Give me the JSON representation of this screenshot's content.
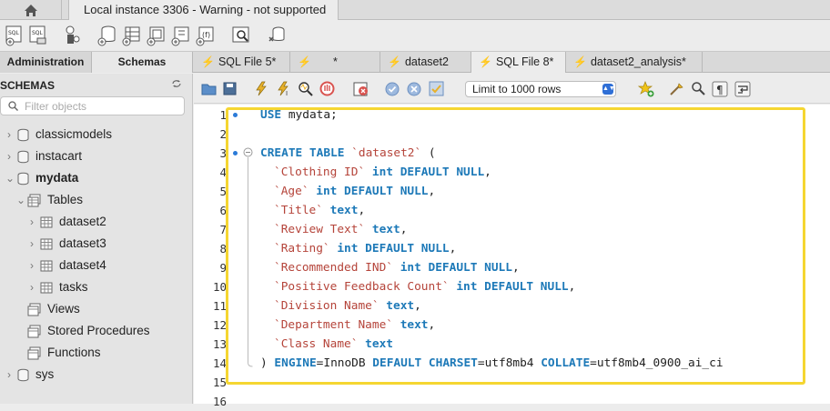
{
  "window": {
    "connection_tab": "Local instance 3306 - Warning - not supported"
  },
  "sidebar": {
    "tab_admin": "Administration",
    "tab_schemas": "Schemas",
    "title": "SCHEMAS",
    "filter_placeholder": "Filter objects",
    "tree": [
      {
        "label": "classicmodels"
      },
      {
        "label": "instacart"
      },
      {
        "label": "mydata"
      },
      {
        "label": "Tables"
      },
      {
        "label": "dataset2"
      },
      {
        "label": "dataset3"
      },
      {
        "label": "dataset4"
      },
      {
        "label": "tasks"
      },
      {
        "label": "Views"
      },
      {
        "label": "Stored Procedures"
      },
      {
        "label": "Functions"
      },
      {
        "label": "sys"
      }
    ]
  },
  "tabs": [
    {
      "label": "SQL File 5*"
    },
    {
      "label": "*"
    },
    {
      "label": "dataset2"
    },
    {
      "label": "SQL File 8*"
    },
    {
      "label": "dataset2_analysis*"
    }
  ],
  "editor_toolbar": {
    "limit_select": "Limit to 1000 rows"
  },
  "editor": {
    "line_numbers": [
      "1",
      "2",
      "3",
      "4",
      "5",
      "6",
      "7",
      "8",
      "9",
      "10",
      "11",
      "12",
      "13",
      "14",
      "15",
      "16"
    ],
    "lines": {
      "l1_kw": "USE",
      "l1_rest": " mydata;",
      "l3_kw": "CREATE TABLE",
      "l3_id": "`dataset2`",
      "l3_rest": " (",
      "l4_id": "`Clothing ID`",
      "l4_kw": " int DEFAULT NULL",
      "l4_rest": ",",
      "l5_id": "`Age`",
      "l5_kw": " int DEFAULT NULL",
      "l5_rest": ",",
      "l6_id": "`Title`",
      "l6_kw": " text",
      "l6_rest": ",",
      "l7_id": "`Review Text`",
      "l7_kw": " text",
      "l7_rest": ",",
      "l8_id": "`Rating`",
      "l8_kw": " int DEFAULT NULL",
      "l8_rest": ",",
      "l9_id": "`Recommended IND`",
      "l9_kw": " int DEFAULT NULL",
      "l9_rest": ",",
      "l10_id": "`Positive Feedback Count`",
      "l10_kw": " int DEFAULT NULL",
      "l10_rest": ",",
      "l11_id": "`Division Name`",
      "l11_kw": " text",
      "l11_rest": ",",
      "l12_id": "`Department Name`",
      "l12_kw": " text",
      "l12_rest": ",",
      "l13_id": "`Class Name`",
      "l13_kw": " text",
      "l14_a": ") ",
      "l14_kw1": "ENGINE",
      "l14_b": "=InnoDB ",
      "l14_kw2": "DEFAULT CHARSET",
      "l14_c": "=utf8mb4 ",
      "l14_kw3": "COLLATE",
      "l14_d": "=utf8mb4_0900_ai_ci"
    }
  },
  "colors": {
    "keyword": "#1d79b8",
    "identifier": "#b5443a",
    "highlight_border": "#f5d631"
  }
}
